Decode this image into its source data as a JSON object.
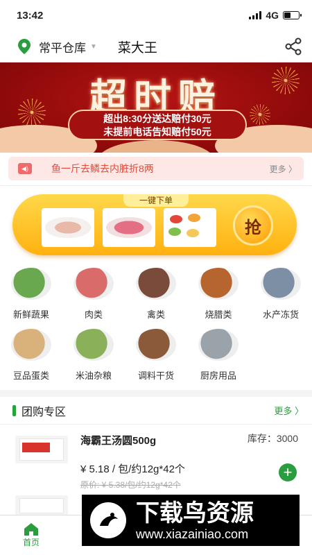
{
  "status_bar": {
    "time": "13:42",
    "network": "4G"
  },
  "header": {
    "warehouse": "常平仓库",
    "store_name": "菜大王"
  },
  "banner": {
    "title": "超时赔",
    "line1": "超出8:30分送达赔付30元",
    "line2": "未提前电话告知赔付50元"
  },
  "notice": {
    "text": "鱼一斤去鳞去内脏折8两",
    "more": "更多 〉"
  },
  "quick_order": {
    "tag": "一键下单",
    "grab": "抢"
  },
  "categories": [
    {
      "label": "新鲜蔬果",
      "icon": "vegetables-icon",
      "color": "#6aa84f"
    },
    {
      "label": "肉类",
      "icon": "meat-icon",
      "color": "#d96b6b"
    },
    {
      "label": "禽类",
      "icon": "poultry-icon",
      "color": "#7a4b3a"
    },
    {
      "label": "烧腊类",
      "icon": "roast-meat-icon",
      "color": "#b5652d"
    },
    {
      "label": "水产冻货",
      "icon": "seafood-icon",
      "color": "#7d8fa5"
    },
    {
      "label": "豆品蛋类",
      "icon": "eggs-icon",
      "color": "#d8b27a"
    },
    {
      "label": "米油杂粮",
      "icon": "grain-icon",
      "color": "#8bb05a"
    },
    {
      "label": "调料干货",
      "icon": "seasoning-icon",
      "color": "#8a5a3a"
    },
    {
      "label": "厨房用品",
      "icon": "kitchenware-icon",
      "color": "#9aa3a9"
    }
  ],
  "group_buy": {
    "title": "团购专区",
    "more": "更多 〉",
    "product": {
      "name": "海霸王汤圆500g",
      "stock": "库存：3000",
      "price": "¥ 5.18 / 包/约12g*42个",
      "original": "原价: ¥ 5.38/包/约12g*42个"
    }
  },
  "tabbar": {
    "home": "首页"
  },
  "watermark": {
    "title": "下载鸟资源",
    "url": "www.xiazainiao.com"
  }
}
